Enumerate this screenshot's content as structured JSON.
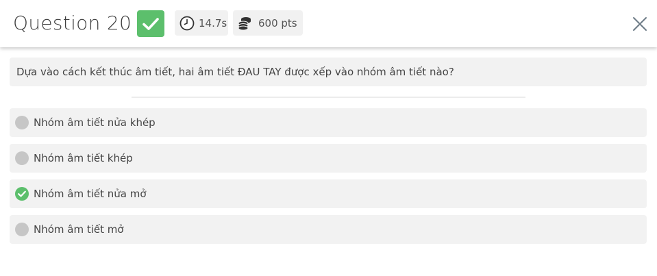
{
  "header": {
    "title": "Question 20",
    "status": "correct",
    "time": "14.7s",
    "points": "600 pts",
    "icons": {
      "status": "check-icon",
      "time": "clock-icon",
      "points": "coins-icon",
      "close": "close-icon"
    }
  },
  "question": {
    "text": "Dựa vào cách kết thúc âm tiết, hai âm tiết ĐAU TAY được xếp vào nhóm âm tiết nào?"
  },
  "options": [
    {
      "label": "Nhóm âm tiết nửa khép",
      "selected": false
    },
    {
      "label": "Nhóm âm tiết khép",
      "selected": false
    },
    {
      "label": "Nhóm âm tiết nửa mở",
      "selected": true
    },
    {
      "label": "Nhóm âm tiết mở",
      "selected": false
    }
  ],
  "colors": {
    "correct": "#5cbf6c",
    "unselected": "#c6c6c6",
    "option_bg": "#f2f2f2",
    "chip_bg": "#f1f1f1",
    "close": "#6c7b86"
  }
}
